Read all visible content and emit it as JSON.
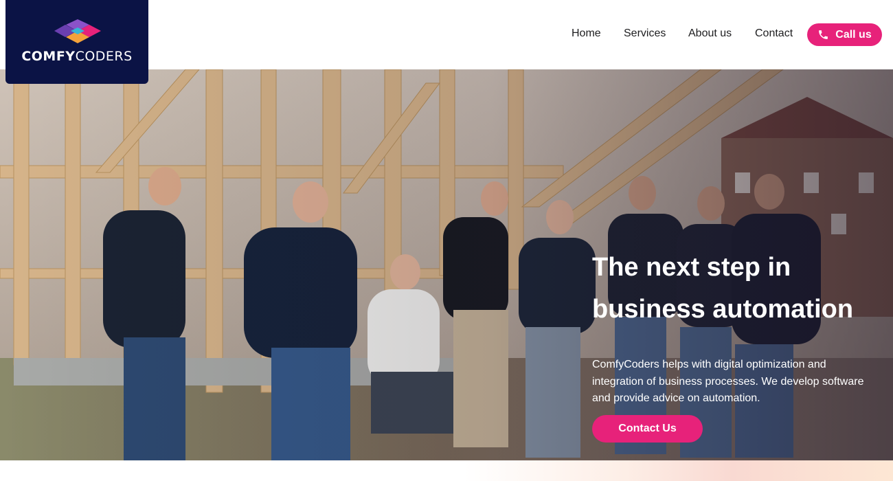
{
  "brand": {
    "name_bold": "COMFY",
    "name_light": "CODERS",
    "colors": {
      "navy": "#0b1345",
      "accent": "#e7227a"
    },
    "logo_icon": "diamond-logo-icon"
  },
  "nav": {
    "items": [
      {
        "label": "Home"
      },
      {
        "label": "Services"
      },
      {
        "label": "About us"
      },
      {
        "label": "Contact"
      }
    ],
    "call_button": {
      "label": "Call us",
      "icon": "phone-icon"
    }
  },
  "hero": {
    "title_line1": "The next step in",
    "title_line2": "business automation",
    "description": "ComfyCoders helps with digital optimization and integration of business processes. We develop software and provide advice on automation.",
    "cta_label": "Contact Us",
    "image_subject": "team-photo"
  }
}
